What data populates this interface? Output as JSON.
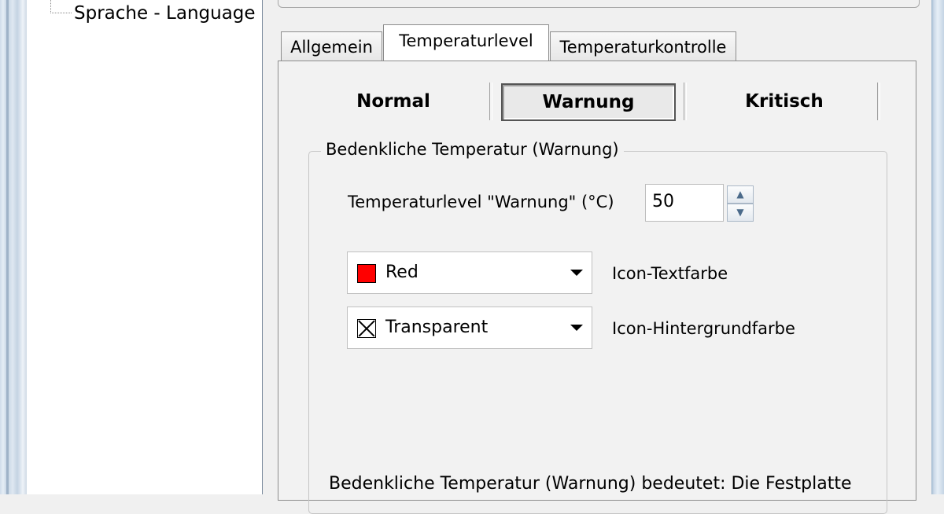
{
  "tree": {
    "item_label": "Sprache - Language"
  },
  "tabs": [
    {
      "label": "Allgemein"
    },
    {
      "label": "Temperaturlevel"
    },
    {
      "label": "Temperaturkontrolle"
    }
  ],
  "levels": [
    {
      "label": "Normal"
    },
    {
      "label": "Warnung"
    },
    {
      "label": "Kritisch"
    }
  ],
  "group": {
    "title": "Bedenkliche Temperatur (Warnung)",
    "threshold_label": "Temperaturlevel \"Warnung\" (°C)",
    "threshold_value": "50",
    "text_color": {
      "value": "Red",
      "swatch": "#ff0000",
      "label": "Icon-Textfarbe"
    },
    "bg_color": {
      "value": "Transparent",
      "label": "Icon-Hintergrundfarbe"
    },
    "description": "Bedenkliche Temperatur (Warnung) bedeutet: Die Festplatte"
  }
}
